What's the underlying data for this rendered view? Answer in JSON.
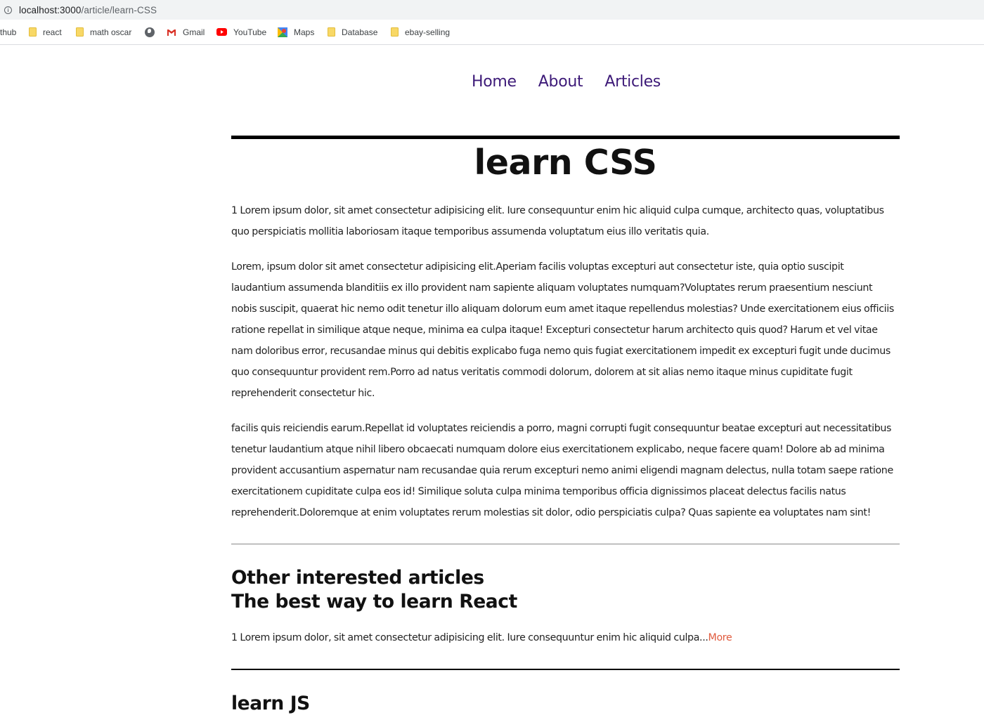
{
  "browser": {
    "url_host": "localhost:3000",
    "url_path": "/article/learn-CSS",
    "bookmarks": [
      {
        "label": "thub",
        "icon": "none"
      },
      {
        "label": "react",
        "icon": "folder-icon"
      },
      {
        "label": "math oscar",
        "icon": "folder-icon"
      },
      {
        "label": "",
        "icon": "globe-icon"
      },
      {
        "label": "Gmail",
        "icon": "gmail-icon"
      },
      {
        "label": "YouTube",
        "icon": "youtube-icon"
      },
      {
        "label": "Maps",
        "icon": "maps-icon"
      },
      {
        "label": "Database",
        "icon": "folder-icon"
      },
      {
        "label": "ebay-selling",
        "icon": "folder-icon"
      }
    ]
  },
  "nav": {
    "items": [
      "Home",
      "About",
      "Articles"
    ],
    "link_color": "#3d1a78"
  },
  "article": {
    "title": "learn CSS",
    "paragraphs": [
      "1 Lorem ipsum dolor, sit amet consectetur adipisicing elit. Iure consequuntur enim hic aliquid culpa cumque, architecto quas, voluptatibus quo perspiciatis mollitia laboriosam itaque temporibus assumenda voluptatum eius illo veritatis quia.",
      "Lorem, ipsum dolor sit amet consectetur adipisicing elit.Aperiam facilis voluptas excepturi aut consectetur iste, quia optio suscipit laudantium assumenda blanditiis ex illo provident nam sapiente aliquam voluptates numquam?Voluptates rerum praesentium nesciunt nobis suscipit, quaerat hic nemo odit tenetur illo aliquam dolorum eum amet itaque repellendus molestias? Unde exercitationem eius officiis ratione repellat in similique atque neque, minima ea culpa itaque! Excepturi consectetur harum architecto quis quod? Harum et vel vitae nam doloribus error, recusandae minus qui debitis explicabo fuga nemo quis fugiat exercitationem impedit ex excepturi fugit unde ducimus quo consequuntur provident rem.Porro ad natus veritatis commodi dolorum, dolorem at sit alias nemo itaque minus cupiditate fugit reprehenderit consectetur hic.",
      "facilis quis reiciendis earum.Repellat id voluptates reiciendis a porro, magni corrupti fugit consequuntur beatae excepturi aut necessitatibus tenetur laudantium atque nihil libero obcaecati numquam dolore eius exercitationem explicabo, neque facere quam! Dolore ab ad minima provident accusantium aspernatur nam recusandae quia rerum excepturi nemo animi eligendi magnam delectus, nulla totam saepe ratione exercitationem cupiditate culpa eos id! Similique soluta culpa minima temporibus officia dignissimos placeat delectus facilis natus reprehenderit.Doloremque at enim voluptates rerum molestias sit dolor, odio perspiciatis culpa? Quas sapiente ea voluptates nam sint!"
    ]
  },
  "related": {
    "heading": "Other interested articles",
    "items": [
      {
        "title": "The best way to learn React",
        "excerpt": "1 Lorem ipsum dolor, sit amet consectetur adipisicing elit. Iure consequuntur enim hic aliquid culpa...",
        "more_label": "More"
      },
      {
        "title": "learn JS"
      }
    ],
    "more_color": "#e05b3e"
  }
}
